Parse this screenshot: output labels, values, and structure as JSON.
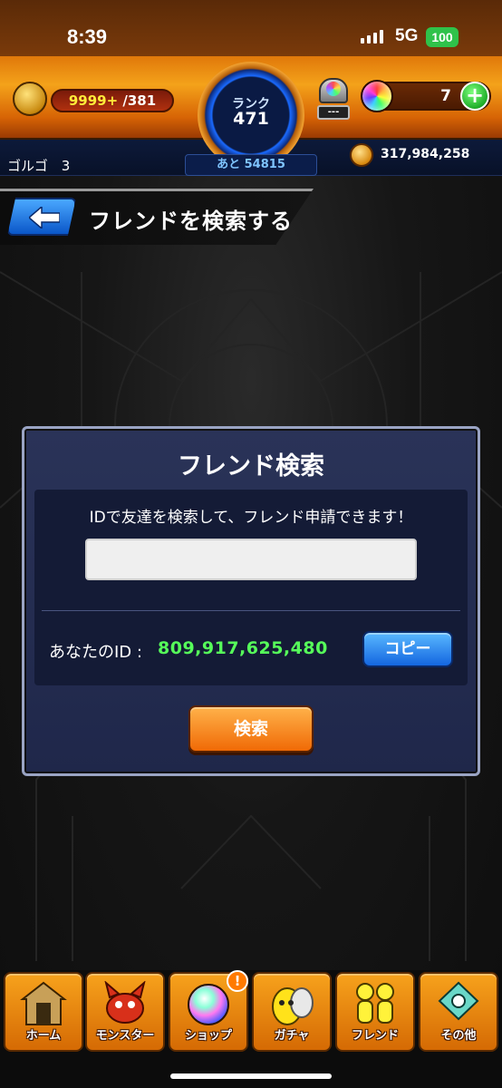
{
  "status_bar": {
    "time": "8:39",
    "network": "5G",
    "battery": "100"
  },
  "header": {
    "stamina_current": "9999+",
    "stamina_max": " /381",
    "rank_label": "ランク",
    "rank_value": "471",
    "next_exp": "あと 54815",
    "item_plate": "---",
    "orb_count": "7",
    "plus_label": "+",
    "player_name": "ゴルゴ　3",
    "coins": "317,984,258"
  },
  "page": {
    "title": "フレンドを検索する"
  },
  "dialog": {
    "title": "フレンド検索",
    "description": "IDで友達を検索して、フレンド申請できます！",
    "input_value": "",
    "input_placeholder": "",
    "your_id_label": "あなたのID :",
    "your_id_value": "809,917,625,480",
    "copy_button": "コピー",
    "search_button": "検索"
  },
  "nav": {
    "home": "ホーム",
    "monster": "モンスター",
    "shop": "ショップ",
    "gacha": "ガチャ",
    "friend": "フレンド",
    "other": "その他",
    "shop_badge": "!"
  },
  "colors": {
    "id_value": "#56ff5a",
    "copy_button": "#1466e0",
    "search_button": "#f06a06",
    "accent_orange": "#f4a21a"
  }
}
